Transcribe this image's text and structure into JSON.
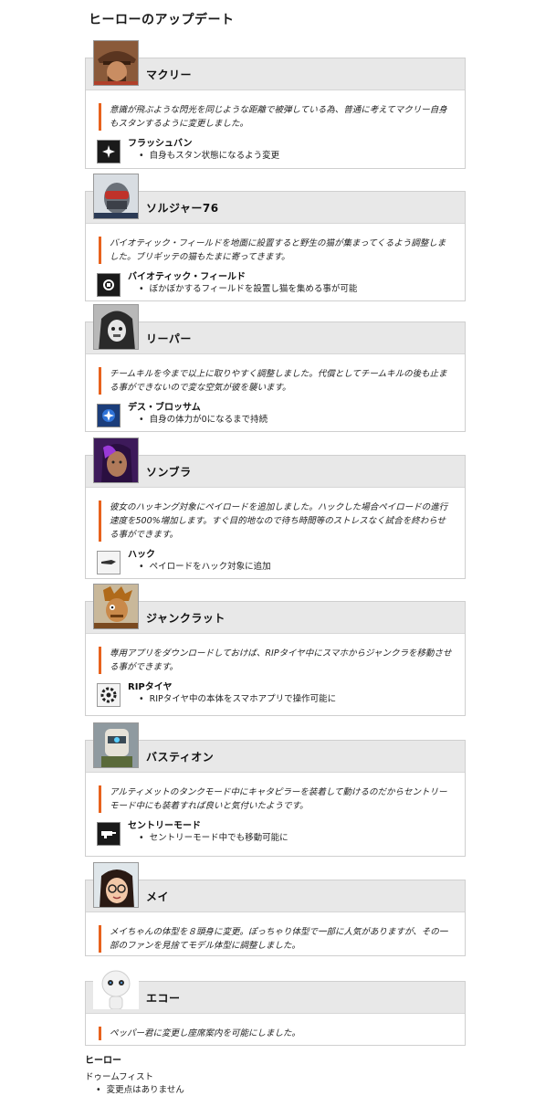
{
  "title": "ヒーローのアップデート",
  "heroes": [
    {
      "name": "マクリー",
      "description": "意識が飛ぶような閃光を同じような距離で被弾している為、普通に考えてマクリー自身もスタンするように変更しました。",
      "ability": {
        "name": "フラッシュバン",
        "note": "自身もスタン状態になるよう変更",
        "icon": "flashbang-icon"
      }
    },
    {
      "name": "ソルジャー76",
      "description": "バイオティック・フィールドを地面に設置すると野生の猫が集まってくるよう調整しました。ブリギッテの猫もたまに寄ってきます。",
      "ability": {
        "name": "バイオティック・フィールド",
        "note": "ぼかぼかするフィールドを設置し猫を集める事が可能",
        "icon": "biotic-field-icon"
      }
    },
    {
      "name": "リーパー",
      "description": "チームキルを今まで以上に取りやすく調整しました。代償としてチームキルの後も止まる事ができないので変な空気が彼を襲います。",
      "ability": {
        "name": "デス・ブロッサム",
        "note": "自身の体力が0になるまで持続",
        "icon": "death-blossom-icon"
      }
    },
    {
      "name": "ソンブラ",
      "description": "彼女のハッキング対象にペイロードを追加しました。ハックした場合ペイロードの進行速度を500%増加します。すぐ目的地なので待ち時間等のストレスなく試合を終わらせる事ができます。",
      "ability": {
        "name": "ハック",
        "note": "ペイロードをハック対象に追加",
        "icon": "hack-icon"
      }
    },
    {
      "name": "ジャンクラット",
      "description": "専用アプリをダウンロードしておけば、RIPタイヤ中にスマホからジャンクラを移動させる事ができます。",
      "ability": {
        "name": "RIPタイヤ",
        "note": "RIPタイヤ中の本体をスマホアプリで操作可能に",
        "icon": "rip-tire-icon"
      }
    },
    {
      "name": "バスティオン",
      "description": "アルティメットのタンクモード中にキャタピラーを装着して動けるのだからセントリーモード中にも装着すれば良いと気付いたようです。",
      "ability": {
        "name": "セントリーモード",
        "note": "セントリーモード中でも移動可能に",
        "icon": "sentry-mode-icon"
      }
    },
    {
      "name": "メイ",
      "description": "メイちゃんの体型を８頭身に変更。ぽっちゃり体型で一部に人気がありますが、その一部のファンを見捨てモデル体型に調整しました。"
    },
    {
      "name": "エコー",
      "description": "ペッパー君に変更し座席案内を可能にしました。"
    }
  ],
  "footer": {
    "title": "ヒーロー",
    "hero": "ドゥームフィスト",
    "note": "変更点はありません"
  }
}
